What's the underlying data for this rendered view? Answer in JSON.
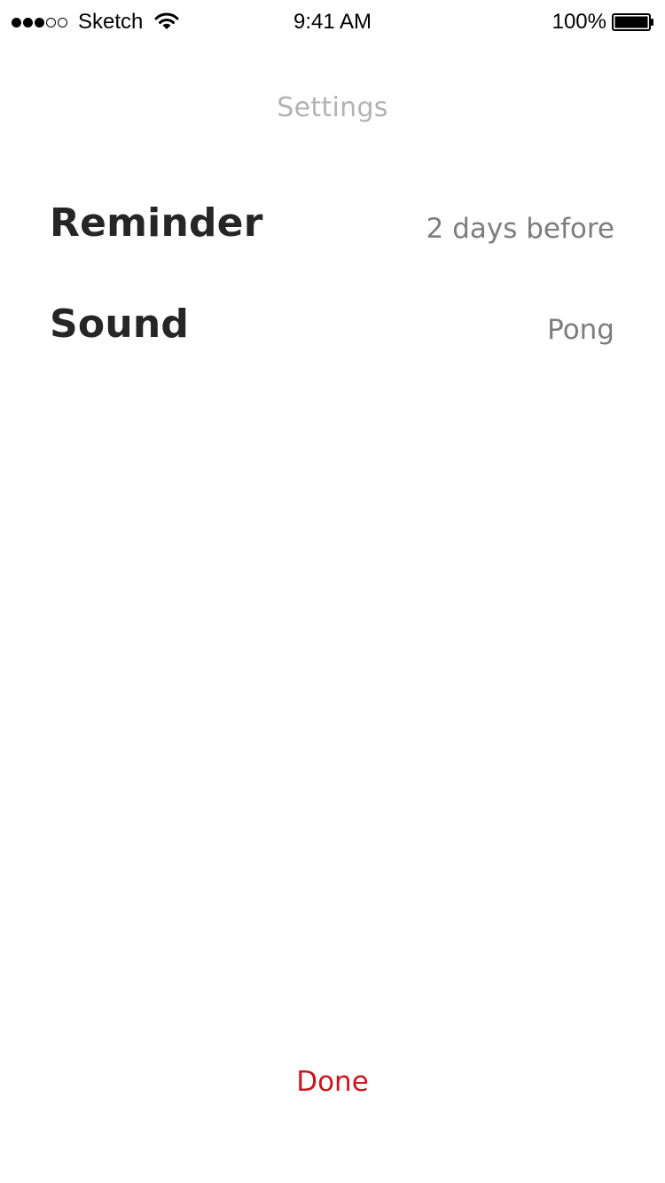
{
  "status_bar": {
    "signal_dots": [
      true,
      true,
      true,
      false,
      false
    ],
    "carrier": "Sketch",
    "wifi_icon": "wifi-icon",
    "time": "9:41 AM",
    "battery_percent": "100%",
    "battery_icon": "battery-icon",
    "battery_level": 1.0
  },
  "header": {
    "title": "Settings"
  },
  "settings": {
    "items": [
      {
        "label": "Reminder",
        "value": "2 days before"
      },
      {
        "label": "Sound",
        "value": "Pong"
      }
    ]
  },
  "footer": {
    "done_label": "Done"
  },
  "colors": {
    "accent": "#c9181f",
    "title": "#b3b3b3",
    "value": "#7d7d7d",
    "label": "#262626"
  }
}
